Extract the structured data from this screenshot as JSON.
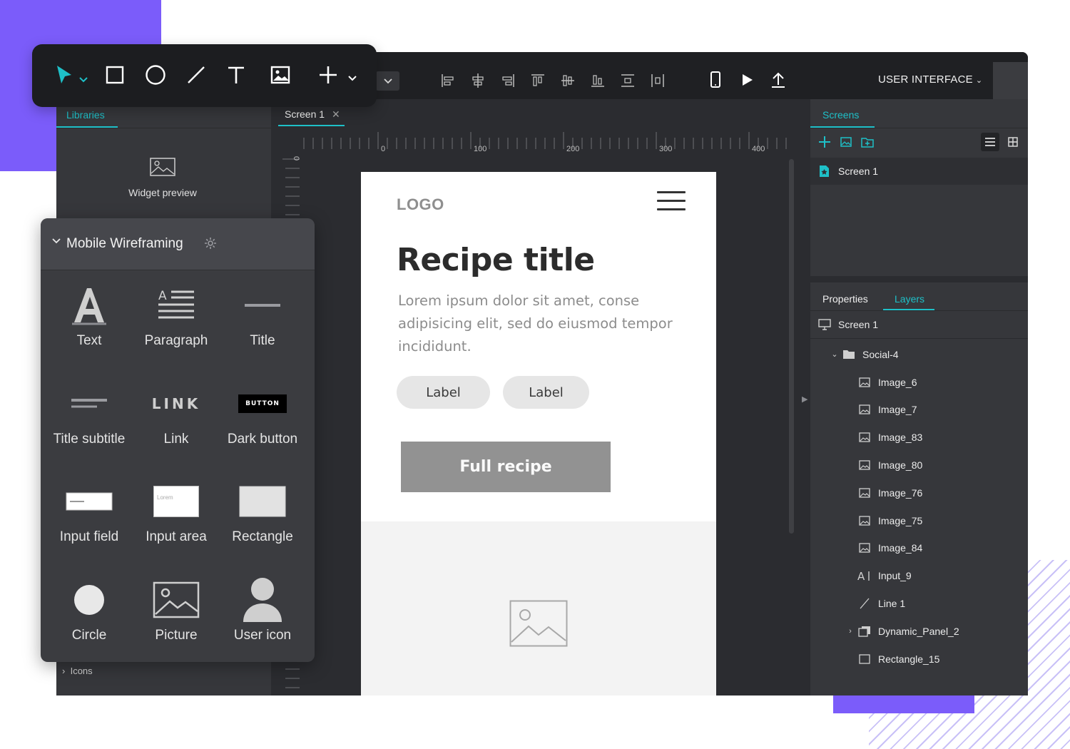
{
  "colors": {
    "accent": "#1ec0c8",
    "purple": "#7b5cfa",
    "dark_bg": "#2b2c30",
    "panel_bg": "#36373b"
  },
  "topbar": {
    "mode_select": "USER INTERFACE"
  },
  "drawing_toolbar": {
    "tools": [
      "pointer-icon",
      "rectangle-icon",
      "ellipse-icon",
      "line-icon",
      "text-icon",
      "image-icon",
      "add-icon"
    ]
  },
  "libraries": {
    "tab_label": "Libraries",
    "widget_preview_label": "Widget preview",
    "icons_section_label": "Icons"
  },
  "mobile_wireframing": {
    "title": "Mobile Wireframing",
    "widgets": [
      {
        "label": "Text",
        "icon": "text-widget-icon"
      },
      {
        "label": "Paragraph",
        "icon": "paragraph-widget-icon"
      },
      {
        "label": "Title",
        "icon": "title-widget-icon"
      },
      {
        "label": "Title subtitle",
        "icon": "title-subtitle-widget-icon"
      },
      {
        "label": "Link",
        "icon": "link-widget-icon",
        "preview_text": "LINK"
      },
      {
        "label": "Dark button",
        "icon": "dark-button-widget-icon",
        "preview_text": "BUTTON"
      },
      {
        "label": "Input field",
        "icon": "input-field-widget-icon"
      },
      {
        "label": "Input area",
        "icon": "input-area-widget-icon",
        "preview_text": "Lorem"
      },
      {
        "label": "Rectangle",
        "icon": "rectangle-widget-icon"
      },
      {
        "label": "Circle",
        "icon": "circle-widget-icon"
      },
      {
        "label": "Picture",
        "icon": "picture-widget-icon"
      },
      {
        "label": "User icon",
        "icon": "user-widget-icon"
      }
    ]
  },
  "canvas": {
    "tab_label": "Screen 1",
    "ruler_labels": [
      "0",
      "100",
      "200",
      "300",
      "400"
    ],
    "ruler_left_label": "0"
  },
  "artboard": {
    "logo": "LOGO",
    "title": "Recipe title",
    "body": "Lorem ipsum dolor sit amet, conse adipisicing elit, sed do eiusmod tempor incididunt.",
    "pill_1": "Label",
    "pill_2": "Label",
    "cta": "Full recipe"
  },
  "screens_panel": {
    "tab_label": "Screens",
    "screens": [
      "Screen 1"
    ]
  },
  "layers_panel": {
    "tab_properties": "Properties",
    "tab_layers": "Layers",
    "root": "Screen 1",
    "group": "Social-4",
    "layers": [
      {
        "name": "Image_6",
        "icon": "image-layer-icon"
      },
      {
        "name": "Image_7",
        "icon": "image-layer-icon"
      },
      {
        "name": "Image_83",
        "icon": "image-layer-icon"
      },
      {
        "name": "Image_80",
        "icon": "image-layer-icon"
      },
      {
        "name": "Image_76",
        "icon": "image-layer-icon"
      },
      {
        "name": "Image_75",
        "icon": "image-layer-icon"
      },
      {
        "name": "Image_84",
        "icon": "image-layer-icon"
      },
      {
        "name": "Input_9",
        "icon": "input-layer-icon"
      },
      {
        "name": "Line 1",
        "icon": "line-layer-icon"
      },
      {
        "name": "Dynamic_Panel_2",
        "icon": "dynamic-panel-layer-icon"
      },
      {
        "name": "Rectangle_15",
        "icon": "rectangle-layer-icon"
      }
    ]
  }
}
